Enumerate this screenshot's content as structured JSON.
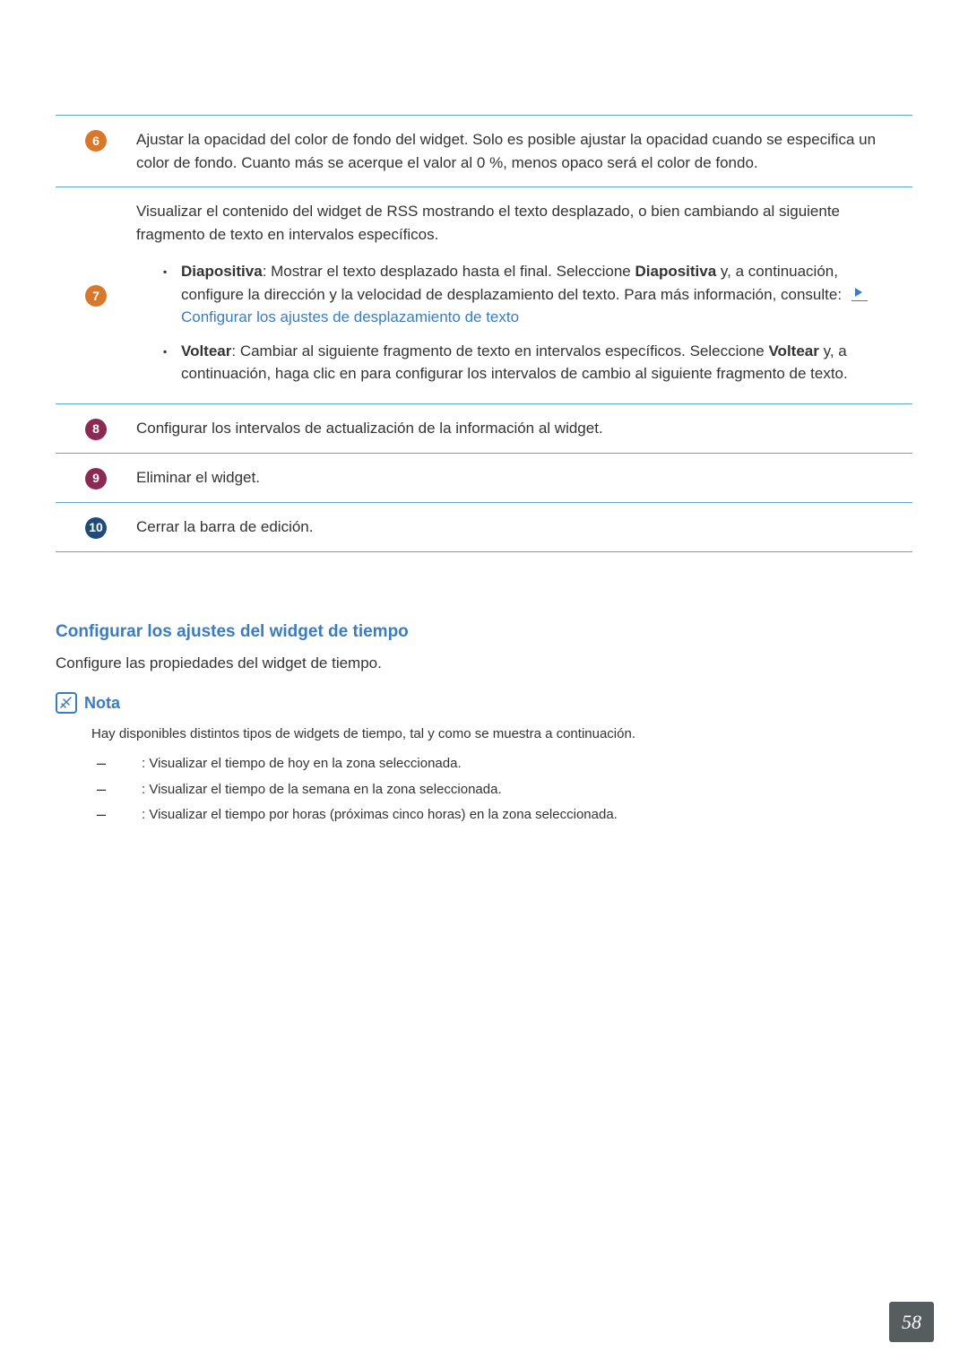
{
  "rows": [
    {
      "num": "6",
      "color": "orange",
      "text": "Ajustar la opacidad del color de fondo del widget. Solo es posible ajustar la opacidad cuando se especifica un color de fondo. Cuanto más se acerque el valor al 0 %, menos opaco será el color de fondo."
    },
    {
      "num": "7",
      "color": "orange",
      "intro": "Visualizar el contenido del widget de RSS mostrando el texto desplazado, o bien cambiando al siguiente fragmento de texto en intervalos específicos.",
      "sub1_bold": "Diapositiva",
      "sub1_a": ": Mostrar el texto desplazado hasta el final. Seleccione ",
      "sub1_bold2": "Diapositiva",
      "sub1_b": " y, a continuación, configure la dirección y la velocidad de desplazamiento del texto. Para más información, consulte:",
      "sub1_link": "Configurar los ajustes de desplazamiento de texto",
      "sub2_bold": "Voltear",
      "sub2_a": ": Cambiar al siguiente fragmento de texto en intervalos específicos. Seleccione ",
      "sub2_bold2": "Voltear",
      "sub2_b": " y, a continuación, haga clic en         para configurar los intervalos de cambio al siguiente fragmento de texto."
    },
    {
      "num": "8",
      "color": "maroon",
      "text": "Configurar los intervalos de actualización de la información al widget."
    },
    {
      "num": "9",
      "color": "maroon",
      "text": "Eliminar el widget."
    },
    {
      "num": "10",
      "color": "navy",
      "text": "Cerrar la barra de edición."
    }
  ],
  "section": {
    "title": "Configurar los ajustes del widget de tiempo",
    "sub": "Configure las propiedades del widget de tiempo."
  },
  "nota": {
    "label": "Nota",
    "intro": "Hay disponibles distintos tipos de widgets de tiempo, tal y como se muestra a continuación.",
    "items": [
      ": Visualizar el tiempo de hoy en la zona seleccionada.",
      ": Visualizar el tiempo de la semana en la zona seleccionada.",
      ": Visualizar el tiempo por horas (próximas cinco horas) en la zona seleccionada."
    ]
  },
  "page": "58"
}
